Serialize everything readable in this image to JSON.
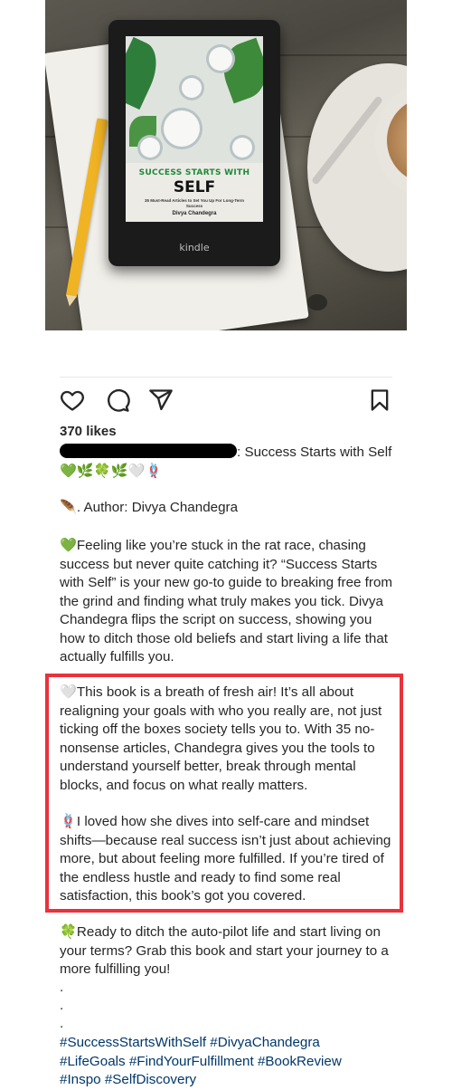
{
  "post": {
    "kindle_brand": "kindle",
    "cover_title": "SUCCESS STARTS WITH",
    "cover_self": "SELF",
    "cover_subtitle": "35 Must-Read Articles to Set You Up For Long-Term Success",
    "cover_author": "Divya Chandegra"
  },
  "likes": "370 likes",
  "caption": {
    "text": ": Success Starts with Self 💚🌿🍀🌿🤍🪢"
  },
  "author_line": "🪶. Author: Divya Chandegra",
  "paragraphs": {
    "p1": "💚Feeling like you’re stuck in the rat race, chasing success but never quite catching it? “Success Starts with Self” is your new go-to guide to breaking free from the grind and finding what truly makes you tick. Divya Chandegra flips the script on success, showing you how to ditch those old beliefs and start living a life that actually fulfills you.",
    "p2": "🤍This book is a breath of fresh air! It’s all about realigning your goals with who you really are, not just ticking off the boxes society tells you to. With 35 no-nonsense articles, Chandegra gives you the tools to understand yourself better, break through mental blocks, and focus on what really matters.",
    "p3": "🪢I loved how she dives into self-care and mindset shifts—because real success isn’t just about achieving more, but about feeling more fulfilled. If you’re tired of the endless hustle and ready to find some real satisfaction, this book’s got you covered.",
    "p4": "🍀Ready to ditch the auto-pilot life and start living on your terms? Grab this book and start your journey to a more fulfilling you!"
  },
  "dots": [
    ".",
    ".",
    "."
  ],
  "hashtags": {
    "h1": "#SuccessStartsWithSelf",
    "h2": "#DivyaChandegra",
    "h3": "#LifeGoals",
    "h4": "#FindYourFulfillment",
    "h5": "#BookReview",
    "h6": "#Inspo",
    "h7": "#SelfDiscovery"
  },
  "icons": {
    "like": "heart-icon",
    "comment": "comment-bubble-icon",
    "share": "paper-plane-icon",
    "save": "bookmark-icon"
  },
  "colors": {
    "highlight_border": "#e8323c",
    "hashtag": "#00376b",
    "cover_green": "#1f8a3a"
  }
}
